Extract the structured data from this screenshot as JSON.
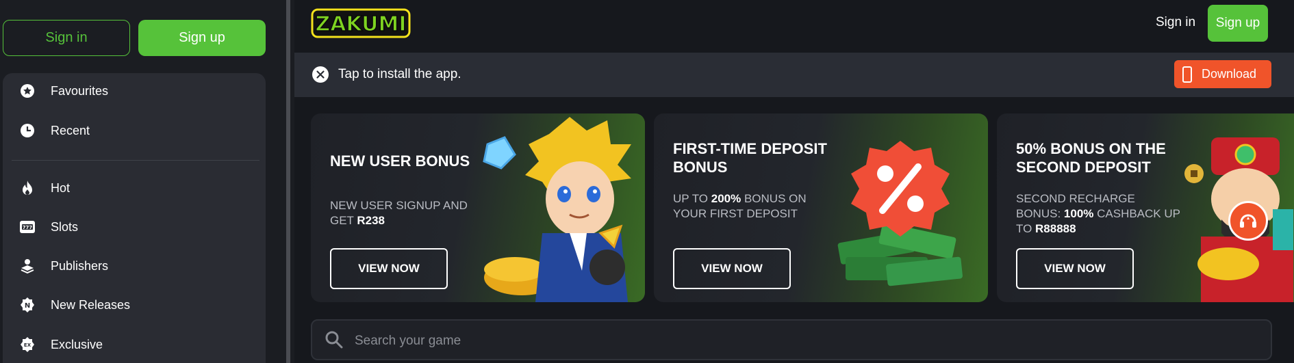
{
  "sidebar": {
    "sign_in": "Sign in",
    "sign_up": "Sign up",
    "items": [
      {
        "label": "Favourites",
        "icon": "star-icon"
      },
      {
        "label": "Recent",
        "icon": "clock-icon"
      },
      {
        "label": "Hot",
        "icon": "flame-icon"
      },
      {
        "label": "Slots",
        "icon": "slot-machine-icon"
      },
      {
        "label": "Publishers",
        "icon": "publisher-icon"
      },
      {
        "label": "New Releases",
        "icon": "new-badge-icon"
      },
      {
        "label": "Exclusive",
        "icon": "exclusive-badge-icon"
      }
    ]
  },
  "header": {
    "logo_text": "ZAKUMI",
    "sign_in": "Sign in",
    "sign_up": "Sign up"
  },
  "install_bar": {
    "message": "Tap to install the app.",
    "download": "Download"
  },
  "promos": [
    {
      "title": "NEW USER BONUS",
      "desc_prefix": "NEW USER SIGNUP AND GET ",
      "desc_bold": "R238",
      "button": "VIEW NOW"
    },
    {
      "title": "FIRST-TIME DEPOSIT BONUS",
      "desc_prefix": "UP TO ",
      "desc_bold": "200%",
      "desc_suffix": " BONUS ON YOUR FIRST DEPOSIT",
      "button": "VIEW NOW"
    },
    {
      "title": "50% BONUS ON THE SECOND DEPOSIT",
      "desc_prefix": "SECOND RECHARGE BONUS: ",
      "desc_bold": "100%",
      "desc_mid": " CASHBACK UP TO ",
      "desc_bold2": "R88888",
      "button": "VIEW NOW"
    }
  ],
  "search": {
    "placeholder": "Search your game"
  },
  "colors": {
    "accent_green": "#56c23a",
    "download_orange": "#f0542a",
    "background": "#16181d"
  }
}
